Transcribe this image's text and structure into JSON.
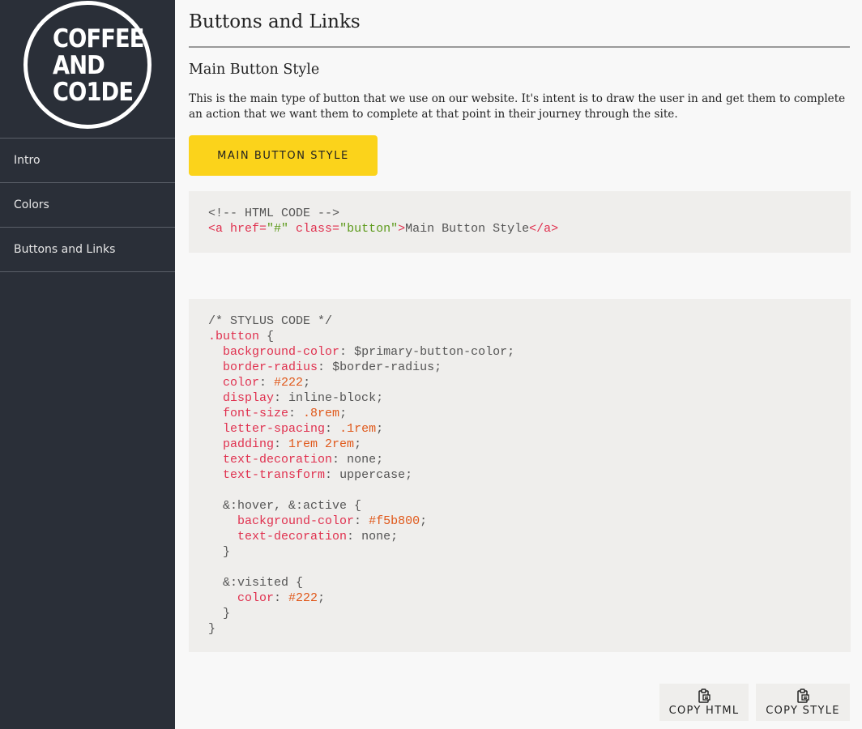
{
  "sidebar": {
    "logo": {
      "line1": "COFFEE",
      "line2": "AND",
      "line3": "CO1DE"
    },
    "items": [
      {
        "label": "Intro"
      },
      {
        "label": "Colors"
      },
      {
        "label": "Buttons and Links"
      }
    ]
  },
  "main": {
    "title": "Buttons and Links",
    "section_title": "Main Button Style",
    "description": "This is the main type of button that we use on our website. It's intent is to draw the user in and get them to complete an action that we want them to complete at that point in their journey through the site.",
    "button_label": "MAIN BUTTON STYLE",
    "html_code": {
      "comment": "<!-- HTML CODE -->",
      "open_tag": "<a ",
      "attr_href": "href=",
      "val_href": "\"#\"",
      "attr_class": " class=",
      "val_class": "\"button\"",
      "tag_close": ">",
      "text": "Main Button Style",
      "end_tag": "</a>"
    },
    "css_code": {
      "comment": "/* STYLUS CODE */",
      "selector": ".button",
      "lines": [
        {
          "prop": "background-color",
          "value": "$primary-button-color",
          "kind": "plain"
        },
        {
          "prop": "border-radius",
          "value": "$border-radius",
          "kind": "plain"
        },
        {
          "prop": "color",
          "value": "#222",
          "kind": "num"
        },
        {
          "prop": "display",
          "value": "inline-block",
          "kind": "plain"
        },
        {
          "prop": "font-size",
          "value": ".8rem",
          "kind": "num"
        },
        {
          "prop": "letter-spacing",
          "value": ".1rem",
          "kind": "num"
        },
        {
          "prop": "padding",
          "value": "1rem 2rem",
          "kind": "num"
        },
        {
          "prop": "text-decoration",
          "value": "none",
          "kind": "plain"
        },
        {
          "prop": "text-transform",
          "value": "uppercase",
          "kind": "plain"
        }
      ],
      "hover_selector": "&:hover, &:active",
      "hover_lines": [
        {
          "prop": "background-color",
          "value": "#f5b800",
          "kind": "num"
        },
        {
          "prop": "text-decoration",
          "value": "none",
          "kind": "plain"
        }
      ],
      "visited_selector": "&:visited",
      "visited_lines": [
        {
          "prop": "color",
          "value": "#222",
          "kind": "num"
        }
      ]
    },
    "copy_html_label": "COPY HTML",
    "copy_style_label": "COPY STYLE"
  },
  "colors": {
    "sidebar_bg": "#2a2f38",
    "button_yellow": "#fbd31b",
    "code_bg": "#efeeec",
    "code_red": "#e0314f",
    "code_green": "#5c9a1a",
    "code_orange": "#e0591b"
  },
  "icons": {
    "copy": "clipboard-icon"
  }
}
